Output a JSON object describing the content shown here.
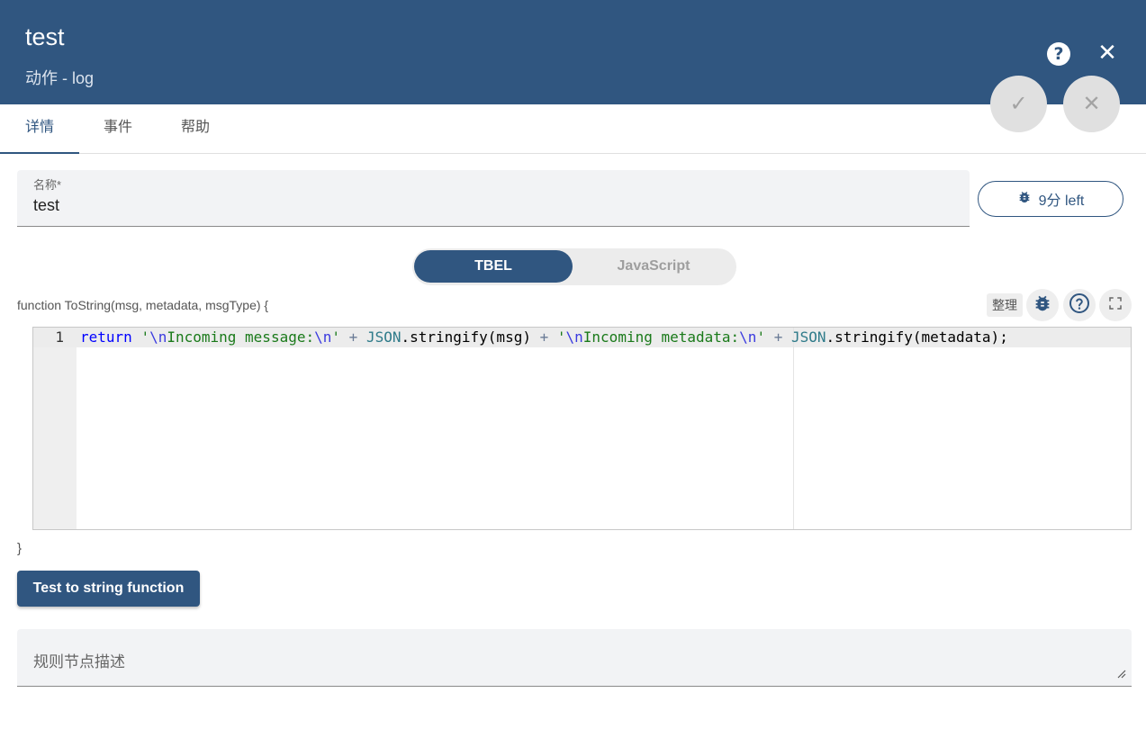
{
  "header": {
    "title": "test",
    "subtitle": "动作 - log",
    "help_icon": "help-circle-icon",
    "close_icon": "close-icon",
    "help_symbol": "?",
    "close_symbol": "✕"
  },
  "fab": {
    "apply_symbol": "✓",
    "cancel_symbol": "✕"
  },
  "tabs": [
    {
      "label": "详情",
      "active": true
    },
    {
      "label": "事件",
      "active": false
    },
    {
      "label": "帮助",
      "active": false
    }
  ],
  "name_field": {
    "label": "名称*",
    "value": "test"
  },
  "debug_button": {
    "icon": "bug-icon",
    "label": "9分 left"
  },
  "language_toggle": {
    "options": [
      "TBEL",
      "JavaScript"
    ],
    "selected": "TBEL"
  },
  "editor": {
    "function_signature": "function ToString(msg, metadata, msgType) {",
    "closing_brace": "}",
    "tidy_label": "整理",
    "line_numbers": [
      "1"
    ],
    "code_line": "return '\\nIncoming message:\\n' + JSON.stringify(msg) + '\\nIncoming metadata:\\n' + JSON.stringify(metadata);"
  },
  "test_button": {
    "label": "Test to string function"
  },
  "description": {
    "placeholder": "规则节点描述"
  },
  "colors": {
    "primary": "#305680",
    "header_bg": "#305680",
    "field_bg": "#f2f3f5"
  }
}
